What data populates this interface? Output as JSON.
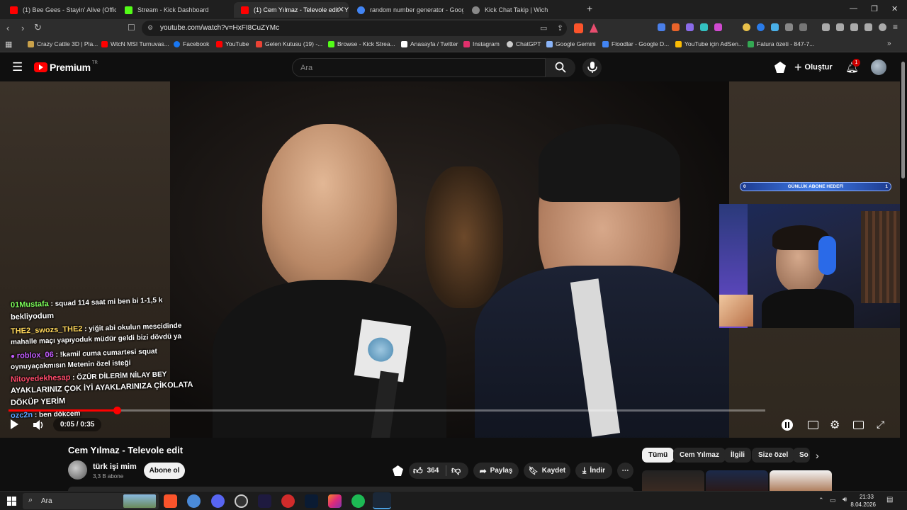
{
  "browser": {
    "tabs": [
      {
        "title": "(1) Bee Gees - Stayin' Alive (Official V",
        "favicon_color": "#ff0000"
      },
      {
        "title": "Stream - Kick Dashboard",
        "favicon_color": "#53fc18"
      },
      {
        "title": "(1) Cem Yılmaz - Televole edit - Y",
        "favicon_color": "#ff0000",
        "active": true
      },
      {
        "title": "random number generator - Google",
        "favicon_color": "#4285f4"
      },
      {
        "title": "Kick Chat Takip | Wich",
        "favicon_color": "#888888"
      }
    ],
    "new_tab": "+",
    "url": "youtube.com/watch?v=HxFI8CuZYMc",
    "bookmarks": [
      {
        "label": "Crazy Cattle 3D | Pla...",
        "color": "#c9a14a"
      },
      {
        "label": "WtcN MSI Turnuvas...",
        "color": "#ff0000"
      },
      {
        "label": "Facebook",
        "color": "#1877f2"
      },
      {
        "label": "YouTube",
        "color": "#ff0000"
      },
      {
        "label": "Gelen Kutusu (19) -...",
        "color": "#ea4335"
      },
      {
        "label": "Browse - Kick Strea...",
        "color": "#53fc18"
      },
      {
        "label": "Anasayfa / Twitter",
        "color": "#ffffff"
      },
      {
        "label": "Instagram",
        "color": "#e1306c"
      },
      {
        "label": "ChatGPT",
        "color": "#cccccc"
      },
      {
        "label": "Google Gemini",
        "color": "#8ab4f8"
      },
      {
        "label": "Floodlar - Google D...",
        "color": "#4285f4"
      },
      {
        "label": "YouTube için AdSen...",
        "color": "#fbbc04"
      },
      {
        "label": "Fatura özeti - 847-7...",
        "color": "#34a853"
      }
    ]
  },
  "youtube": {
    "logo": "Premium",
    "logo_region": "TR",
    "search_placeholder": "Ara",
    "create_label": "Oluştur",
    "notification_count": "1"
  },
  "video": {
    "time": "0:05 / 0:35",
    "progress": 0.143,
    "overlay_goal": "GÜNLÜK ABONE HEDEFİ",
    "overlay_goal_left": "0",
    "overlay_goal_right": "1",
    "chat": [
      {
        "nick": "01Mustafa",
        "nick_color": "#7dff5a",
        "msg": "squad 114 saat mi ben bi 1-1,5 k",
        "msg2": "bekliyodum"
      },
      {
        "nick": "THE2_swozs_THE2",
        "nick_color": "#ffd75a",
        "msg": "yiğit abi okulun mescidinde",
        "msg2": "mahalle maçı yapıyoduk müdür geldi bizi dövdü ya"
      },
      {
        "nick": "roblox_06",
        "nick_color": "#c25aff",
        "msg": "!kamil cuma cumartesi squat",
        "msg2": "oynuyaçakmısın Metenin özel isteği"
      },
      {
        "nick": "Nitoyedekhesap",
        "nick_color": "#ff4a6a",
        "msg": "ÖZÜR DİLERİM NİLAY BEY",
        "msg2": "AYAKLARINIZ ÇOK İYİ AYAKLARINIZA ÇİKOLATA",
        "msg3": "DÖKÜP YERİM"
      },
      {
        "nick": "ozc2n",
        "nick_color": "#5aa0ff",
        "msg": "ben dökcem"
      }
    ]
  },
  "below": {
    "title": "Cem Yılmaz - Televole edit",
    "channel": "türk işi mim",
    "subscribers": "3,3 B abone",
    "subscribe": "Abone ol",
    "likes": "364",
    "share": "Paylaş",
    "save": "Kaydet",
    "download": "İndir",
    "chips": [
      "Tümü",
      "Cem Yılmaz",
      "İlgili",
      "Size özel",
      "So"
    ]
  },
  "taskbar": {
    "search": "Ara",
    "time": "21:33",
    "date": "8.04.2026"
  }
}
